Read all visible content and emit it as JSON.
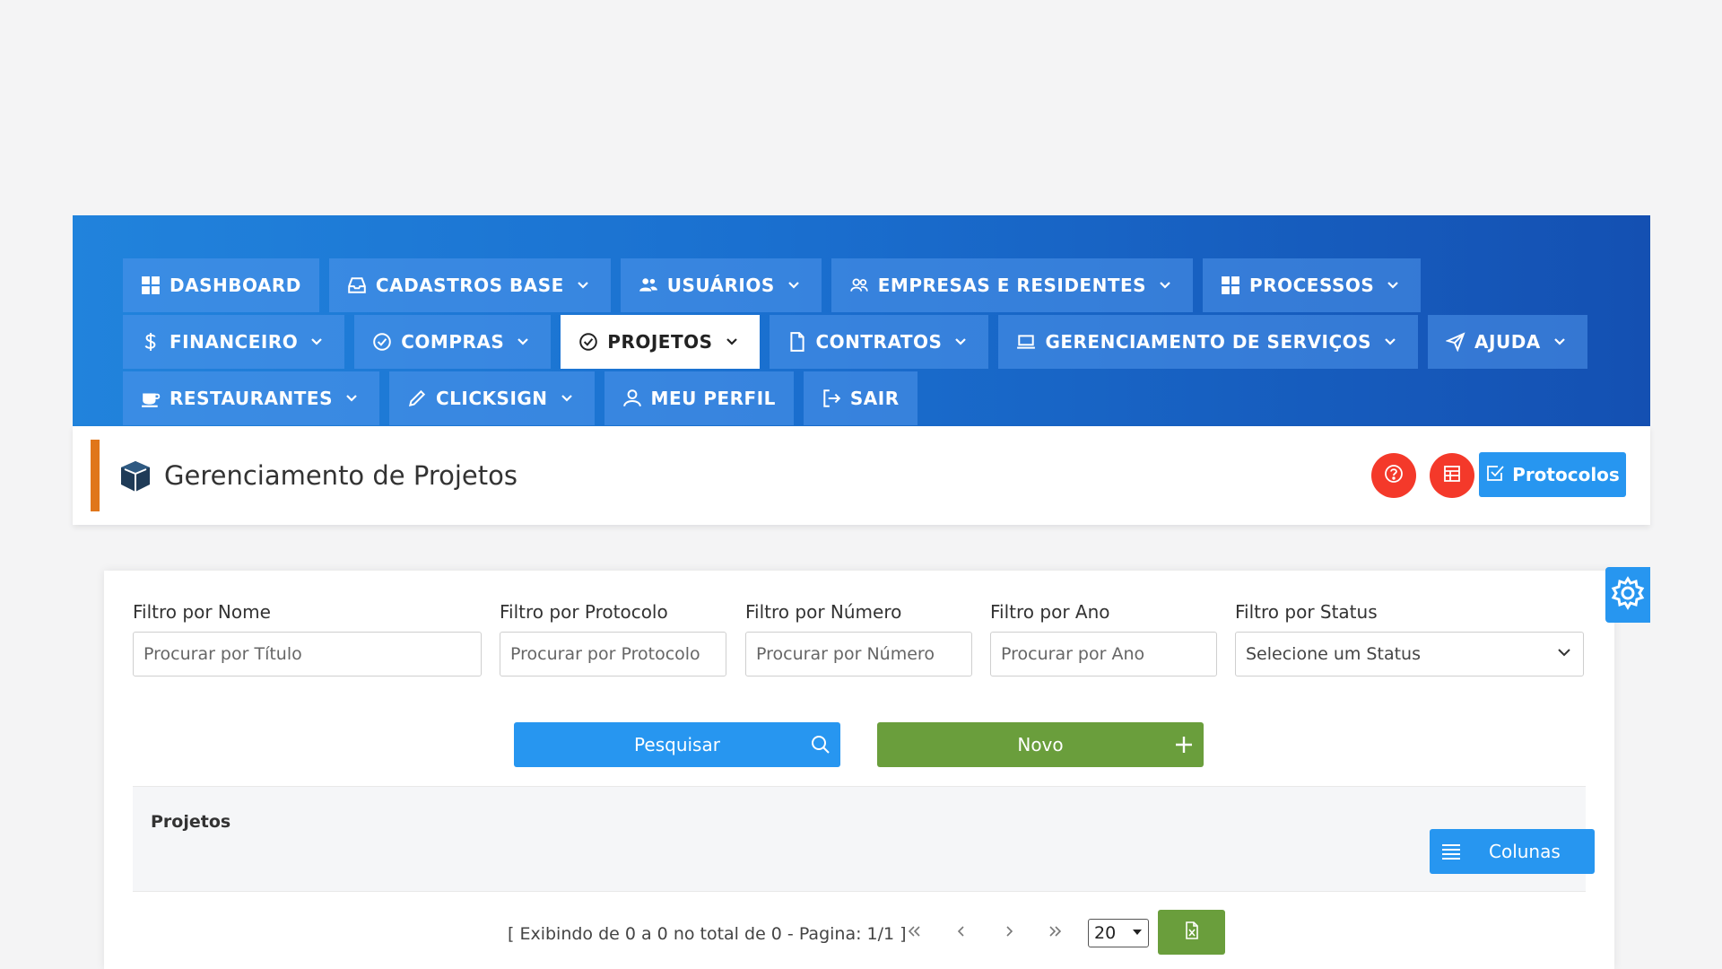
{
  "nav": {
    "row1": [
      {
        "label": "DASHBOARD",
        "icon": "grid-icon",
        "dropdown": false
      },
      {
        "label": "CADASTROS BASE",
        "icon": "inbox-icon",
        "dropdown": true
      },
      {
        "label": "USUÁRIOS",
        "icon": "users-icon",
        "dropdown": true
      },
      {
        "label": "EMPRESAS E RESIDENTES",
        "icon": "people-icon",
        "dropdown": true
      },
      {
        "label": "PROCESSOS",
        "icon": "grid-icon",
        "dropdown": true
      }
    ],
    "row2": [
      {
        "label": "FINANCEIRO",
        "icon": "dollar-icon",
        "dropdown": true
      },
      {
        "label": "COMPRAS",
        "icon": "check-circle-icon",
        "dropdown": true
      },
      {
        "label": "PROJETOS",
        "icon": "check-circle-icon",
        "dropdown": true,
        "active": true
      },
      {
        "label": "CONTRATOS",
        "icon": "file-icon",
        "dropdown": true
      },
      {
        "label": "GERENCIAMENTO DE SERVIÇOS",
        "icon": "laptop-icon",
        "dropdown": true
      },
      {
        "label": "AJUDA",
        "icon": "send-icon",
        "dropdown": true
      }
    ],
    "row3": [
      {
        "label": "RESTAURANTES",
        "icon": "coffee-icon",
        "dropdown": true
      },
      {
        "label": "CLICKSIGN",
        "icon": "pencil-icon",
        "dropdown": true
      },
      {
        "label": "MEU PERFIL",
        "icon": "user-icon",
        "dropdown": false
      },
      {
        "label": "SAIR",
        "icon": "logout-icon",
        "dropdown": false
      }
    ]
  },
  "header": {
    "title": "Gerenciamento de Projetos",
    "protocolos_label": "Protocolos"
  },
  "filters": {
    "nome_label": "Filtro por Nome",
    "nome_placeholder": "Procurar por Título",
    "protocolo_label": "Filtro por Protocolo",
    "protocolo_placeholder": "Procurar por Protocolo",
    "numero_label": "Filtro por Número",
    "numero_placeholder": "Procurar por Número",
    "ano_label": "Filtro por Ano",
    "ano_placeholder": "Procurar por Ano",
    "status_label": "Filtro por Status",
    "status_value": "Selecione um Status"
  },
  "actions": {
    "pesquisar_label": "Pesquisar",
    "novo_label": "Novo"
  },
  "table": {
    "title": "Projetos",
    "colunas_label": "Colunas"
  },
  "pager": {
    "info": "[ Exibindo de 0 a 0 no total de 0 - Pagina: 1/1 ]",
    "page_size": "20"
  },
  "colors": {
    "accent": "#2796f0",
    "success": "#6a9e3c",
    "danger": "#f4392a",
    "orange_bar": "#e0761a"
  }
}
